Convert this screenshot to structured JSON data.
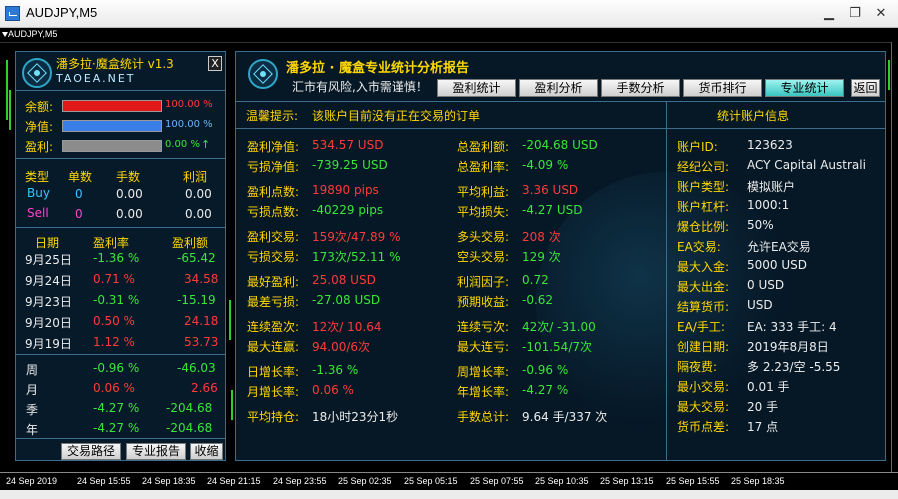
{
  "window": {
    "title": "AUDJPY,M5",
    "minimize_glyph": "▁",
    "restore_glyph": "❐",
    "close_glyph": "✕"
  },
  "chart": {
    "symbol_label": "AUDJPY,M5",
    "x_ticks": [
      "24 Sep 2019",
      "24 Sep 15:55",
      "24 Sep 18:35",
      "24 Sep 21:15",
      "24 Sep 23:55",
      "25 Sep 02:35",
      "25 Sep 05:15",
      "25 Sep 07:55",
      "25 Sep 10:35",
      "25 Sep 13:15",
      "25 Sep 15:55",
      "25 Sep 18:35"
    ]
  },
  "left": {
    "title": "潘多拉·魔盒统计 v1.3",
    "brand": "TAOEA.NET",
    "close_label": "X",
    "balance": {
      "label": "余额:",
      "value": "100.00 %",
      "fill": 1.0,
      "color": "#e01818"
    },
    "equity": {
      "label": "净值:",
      "value": "100.00 %",
      "fill": 1.0,
      "color": "#3a7ee8"
    },
    "profit": {
      "label": "盈利:",
      "value": "0.00 %",
      "arrow": "↑",
      "fill": 1.0,
      "color": "#8c8c8c"
    },
    "positions_header": {
      "type": "类型",
      "count": "单数",
      "lots": "手数",
      "profit": "利润"
    },
    "positions": [
      {
        "type": "Buy",
        "count": "0",
        "lots": "0.00",
        "profit": "0.00"
      },
      {
        "type": "Sell",
        "count": "0",
        "lots": "0.00",
        "profit": "0.00"
      }
    ],
    "daily_header": {
      "date": "日期",
      "rate": "盈利率",
      "amount": "盈利额"
    },
    "daily": [
      {
        "date": "9月25日",
        "rate": "-1.36 %",
        "amount": "-65.42",
        "dir": "down"
      },
      {
        "date": "9月24日",
        "rate": "0.71 %",
        "amount": "34.58",
        "dir": "up"
      },
      {
        "date": "9月23日",
        "rate": "-0.31 %",
        "amount": "-15.19",
        "dir": "down"
      },
      {
        "date": "9月20日",
        "rate": "0.50 %",
        "amount": "24.18",
        "dir": "up"
      },
      {
        "date": "9月19日",
        "rate": "1.12 %",
        "amount": "53.73",
        "dir": "up"
      }
    ],
    "period": [
      {
        "label": "周",
        "rate": "-0.96 %",
        "amount": "-46.03",
        "dir": "down"
      },
      {
        "label": "月",
        "rate": "0.06 %",
        "amount": "2.66",
        "dir": "up"
      },
      {
        "label": "季",
        "rate": "-4.27 %",
        "amount": "-204.68",
        "dir": "down"
      },
      {
        "label": "年",
        "rate": "-4.27 %",
        "amount": "-204.68",
        "dir": "down"
      }
    ],
    "buttons": {
      "path": "交易路径",
      "report": "专业报告",
      "collapse": "收缩"
    }
  },
  "main": {
    "title": "潘多拉 · 魔盒专业统计分析报告",
    "warning": "汇市有风险,入市需谨慎！",
    "tabs": [
      "盈利统计",
      "盈利分析",
      "手数分析",
      "货币排行",
      "专业统计"
    ],
    "active_tab": 4,
    "back_label": "返回",
    "notice_label": "温馨提示:",
    "notice_text": "该账户目前没有正在交易的订单",
    "account_header": "统计账户信息",
    "stats_col1": [
      {
        "label": "盈利净值:",
        "value": "534.57 USD",
        "color": "r"
      },
      {
        "label": "亏损净值:",
        "value": "-739.25 USD",
        "color": "g"
      },
      {
        "label": "盈利点数:",
        "value": "19890 pips",
        "color": "r"
      },
      {
        "label": "亏损点数:",
        "value": "-40229 pips",
        "color": "g"
      },
      {
        "label": "盈利交易:",
        "value": "159次/47.89 %",
        "color": "r"
      },
      {
        "label": "亏损交易:",
        "value": "173次/52.11 %",
        "color": "g"
      },
      {
        "label": "最好盈利:",
        "value": "25.08 USD",
        "color": "r"
      },
      {
        "label": "最差亏损:",
        "value": "-27.08 USD",
        "color": "g"
      },
      {
        "label": "连续盈次:",
        "value": "12次/ 10.64",
        "color": "r"
      },
      {
        "label": "最大连赢:",
        "value": "94.00/6次",
        "color": "r"
      },
      {
        "label": "日增长率:",
        "value": "-1.36 %",
        "color": "g"
      },
      {
        "label": "月增长率:",
        "value": "0.06 %",
        "color": "r"
      },
      {
        "label": "平均持仓:",
        "value": "18小时23分1秒",
        "color": "w"
      }
    ],
    "stats_col2": [
      {
        "label": "总盈利额:",
        "value": "-204.68 USD",
        "color": "g"
      },
      {
        "label": "总盈利率:",
        "value": "-4.09 %",
        "color": "g"
      },
      {
        "label": "平均利益:",
        "value": "3.36 USD",
        "color": "r"
      },
      {
        "label": "平均损失:",
        "value": "-4.27 USD",
        "color": "g"
      },
      {
        "label": "多头交易:",
        "value": "208 次",
        "color": "r"
      },
      {
        "label": "空头交易:",
        "value": "129 次",
        "color": "g"
      },
      {
        "label": "利润因子:",
        "value": "0.72",
        "color": "g"
      },
      {
        "label": "预期收益:",
        "value": "-0.62",
        "color": "g"
      },
      {
        "label": "连续亏次:",
        "value": "42次/ -31.00",
        "color": "g"
      },
      {
        "label": "最大连亏:",
        "value": "-101.54/7次",
        "color": "g"
      },
      {
        "label": "周增长率:",
        "value": "-0.96 %",
        "color": "g"
      },
      {
        "label": "年增长率:",
        "value": "-4.27 %",
        "color": "g"
      },
      {
        "label": "手数总计:",
        "value": "9.64 手/337 次",
        "color": "w"
      }
    ],
    "account": [
      {
        "label": "账户ID:",
        "value": "123623"
      },
      {
        "label": "经纪公司:",
        "value": "ACY Capital Australi"
      },
      {
        "label": "账户类型:",
        "value": "模拟账户"
      },
      {
        "label": "账户杠杆:",
        "value": "1000:1"
      },
      {
        "label": "爆仓比例:",
        "value": "50%"
      },
      {
        "label": "EA交易:",
        "value": "允许EA交易"
      },
      {
        "label": "最大入金:",
        "value": "5000 USD"
      },
      {
        "label": "最大出金:",
        "value": "0 USD"
      },
      {
        "label": "结算货币:",
        "value": "USD"
      },
      {
        "label": "EA/手工:",
        "value": "EA: 333 手工: 4"
      },
      {
        "label": "创建日期:",
        "value": "2019年8月8日"
      },
      {
        "label": "隔夜费:",
        "value": "多 2.23/空 -5.55"
      },
      {
        "label": "最小交易:",
        "value": "0.01 手"
      },
      {
        "label": "最大交易:",
        "value": "20 手"
      },
      {
        "label": "货币点差:",
        "value": "17 点"
      }
    ]
  }
}
